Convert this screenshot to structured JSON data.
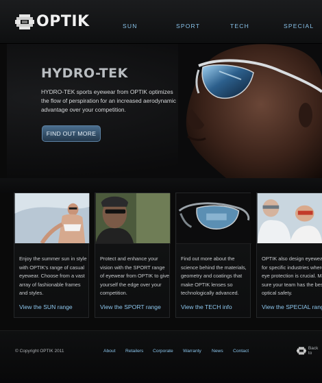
{
  "brand": {
    "name": "OPTIK",
    "icon": "optik-logo-mark"
  },
  "nav": {
    "items": [
      "SUN",
      "SPORT",
      "TECH",
      "SPECIAL"
    ]
  },
  "hero": {
    "title": "HYDRO-TEK",
    "copy": "HYDRO-TEK sports eyewear from OPTIK optimizes the flow of perspiration for an increased aerodynamic advantage over your competition.",
    "button": "FIND OUT MORE"
  },
  "tiles": [
    {
      "lines": [
        "Enjoy the summer sun in style",
        "with OPTIK's range of casual",
        "eyewear. Choose from a vast",
        "array of fashionable frames",
        "and styles."
      ],
      "link": "View the SUN range"
    },
    {
      "lines": [
        "Protect and enhance your",
        "vision with the SPORT range",
        "of eyewear from OPTIK to give",
        "yourself the edge over your",
        "competition."
      ],
      "link": "View the SPORT range"
    },
    {
      "lines": [
        "Find out more about the",
        "science behind the materials,",
        "geometry and coatings that",
        "make OPTIK lenses so",
        "technologically advanced."
      ],
      "link": "View the TECH info"
    },
    {
      "lines": [
        "OPTIK also design eyewear",
        "for specific industries where",
        "eye protection is crucial. Make",
        "sure your team has the best",
        "optical safety."
      ],
      "link": "View the SPECIAL range"
    }
  ],
  "footer": {
    "copyright": "© Copyright OPTIK 2011",
    "links": [
      "About",
      "Retailers",
      "Corporate",
      "Warranty",
      "News",
      "Contact"
    ],
    "back_to_top": "Back to",
    "back_icon": "optik-logo-mark"
  },
  "colors": {
    "accent": "#89c3ea",
    "button": "#3a5873",
    "background": "#0a0a0a"
  }
}
